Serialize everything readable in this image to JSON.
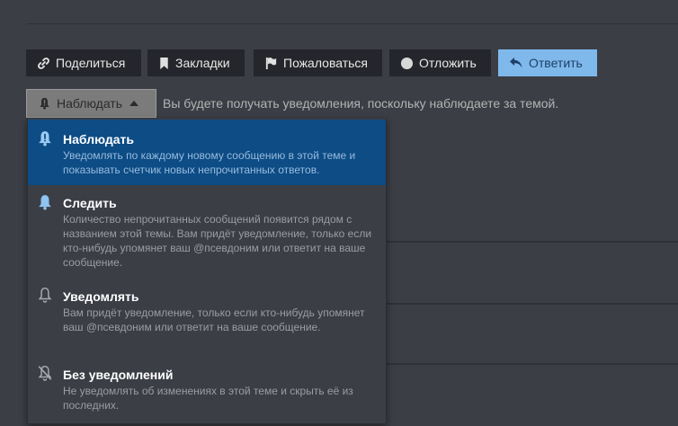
{
  "toolbar": {
    "share": {
      "label": "Поделиться",
      "icon": "link-icon"
    },
    "bookmarks": {
      "label": "Закладки",
      "icon": "bookmark-icon"
    },
    "flag": {
      "label": "Пожаловаться",
      "icon": "flag-icon"
    },
    "defer": {
      "label": "Отложить",
      "icon": "circle-icon"
    },
    "reply": {
      "label": "Ответить",
      "icon": "reply-icon"
    }
  },
  "notifications": {
    "current_label": "Наблюдать",
    "status_text": "Вы будете получать уведомления, поскольку наблюдаете за темой.",
    "options": [
      {
        "title": "Наблюдать",
        "description": "Уведомлять по каждому новому сообщению в этой теме и показывать счетчик новых непрочитанных ответов.",
        "icon": "bell-exclamation-icon",
        "selected": true
      },
      {
        "title": "Следить",
        "description": "Количество непрочитанных сообщений появится рядом с названием этой темы. Вам придёт уведомление, только если кто-нибудь упомянет ваш @псевдоним или ответит на ваше сообщение.",
        "icon": "bell-icon",
        "selected": false
      },
      {
        "title": "Уведомлять",
        "description": "Вам придёт уведомление, только если кто-нибудь упомянет ваш @псевдоним или ответит на ваше сообщение.",
        "icon": "bell-outline-icon",
        "selected": false
      },
      {
        "title": "Без уведомлений",
        "description": "Не уведомлять об изменениях в этой теме и скрыть её из последних.",
        "icon": "bell-slash-icon",
        "selected": false
      }
    ]
  },
  "colors": {
    "background": "#3b3e45",
    "button": "#24262b",
    "primary_button": "#7fb9ec",
    "selected_option": "#0d4c85"
  }
}
